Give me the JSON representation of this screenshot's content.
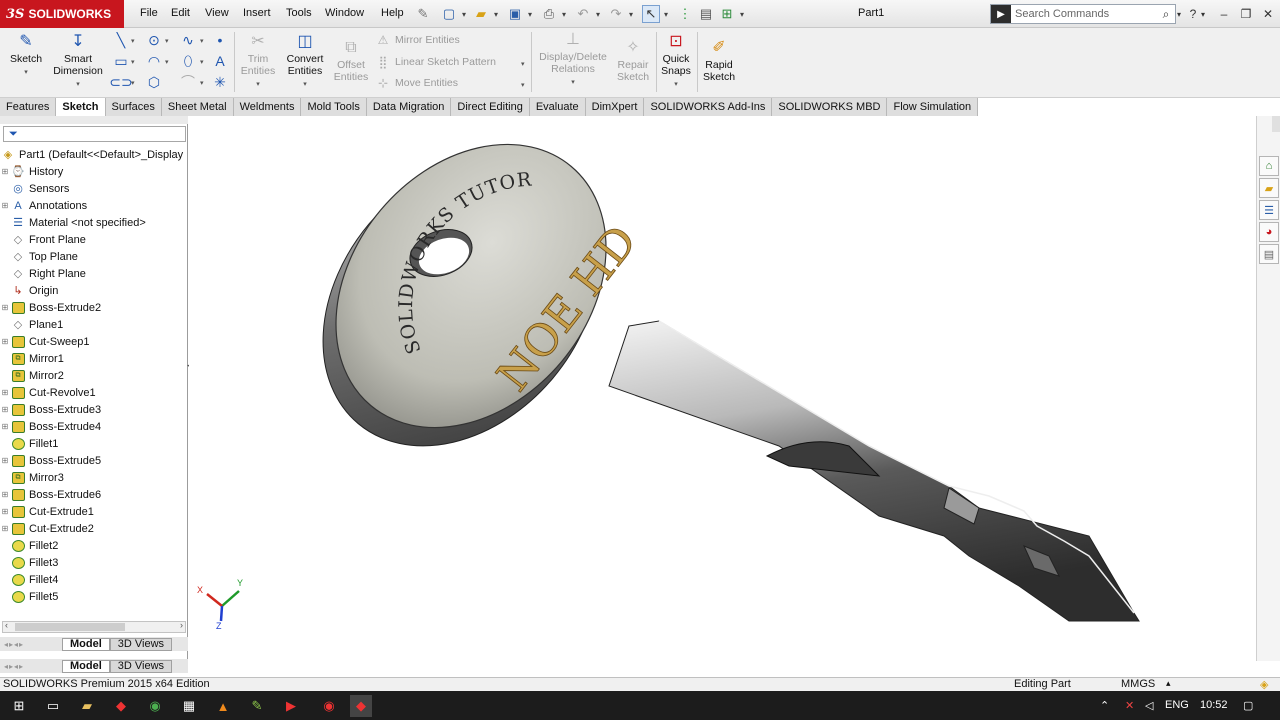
{
  "app": {
    "logo": "SOLIDWORKS",
    "logo_mark": "3S",
    "document_title": "Part1"
  },
  "menu": [
    "File",
    "Edit",
    "View",
    "Insert",
    "Tools",
    "Window",
    "Help"
  ],
  "search": {
    "placeholder": "Search Commands"
  },
  "commands": {
    "sketch": "Sketch",
    "smart_dimension_1": "Smart",
    "smart_dimension_2": "Dimension",
    "trim_1": "Trim",
    "trim_2": "Entities",
    "convert_1": "Convert",
    "convert_2": "Entities",
    "offset_1": "Offset",
    "offset_2": "Entities",
    "mirror_entities": "Mirror Entities",
    "linear_pattern": "Linear Sketch Pattern",
    "move_entities": "Move Entities",
    "display_delete_1": "Display/Delete",
    "display_delete_2": "Relations",
    "repair_1": "Repair",
    "repair_2": "Sketch",
    "quick_snaps_1": "Quick",
    "quick_snaps_2": "Snaps",
    "rapid_sketch_1": "Rapid",
    "rapid_sketch_2": "Sketch"
  },
  "tabs": [
    "Features",
    "Sketch",
    "Surfaces",
    "Sheet Metal",
    "Weldments",
    "Mold Tools",
    "Data Migration",
    "Direct Editing",
    "Evaluate",
    "DimXpert",
    "SOLIDWORKS Add-Ins",
    "SOLIDWORKS MBD",
    "Flow Simulation"
  ],
  "active_tab": "Sketch",
  "tree": {
    "root": "Part1  (Default<<Default>_Display",
    "items": [
      {
        "label": "History",
        "icon": "history-icon"
      },
      {
        "label": "Sensors",
        "icon": "sensor-icon"
      },
      {
        "label": "Annotations",
        "icon": "annotation-icon"
      },
      {
        "label": "Material <not specified>",
        "icon": "material-icon"
      },
      {
        "label": "Front Plane",
        "icon": "plane-icon"
      },
      {
        "label": "Top Plane",
        "icon": "plane-icon"
      },
      {
        "label": "Right Plane",
        "icon": "plane-icon"
      },
      {
        "label": "Origin",
        "icon": "origin-icon"
      },
      {
        "label": "Boss-Extrude2",
        "icon": "feature-icon"
      },
      {
        "label": "Plane1",
        "icon": "plane-icon"
      },
      {
        "label": "Cut-Sweep1",
        "icon": "feature-icon"
      },
      {
        "label": "Mirror1",
        "icon": "mirror-icon"
      },
      {
        "label": "Mirror2",
        "icon": "mirror-icon"
      },
      {
        "label": "Cut-Revolve1",
        "icon": "feature-icon"
      },
      {
        "label": "Boss-Extrude3",
        "icon": "feature-icon"
      },
      {
        "label": "Boss-Extrude4",
        "icon": "feature-icon"
      },
      {
        "label": "Fillet1",
        "icon": "fillet-icon"
      },
      {
        "label": "Boss-Extrude5",
        "icon": "feature-icon"
      },
      {
        "label": "Mirror3",
        "icon": "mirror-icon"
      },
      {
        "label": "Boss-Extrude6",
        "icon": "feature-icon"
      },
      {
        "label": "Cut-Extrude1",
        "icon": "feature-icon"
      },
      {
        "label": "Cut-Extrude2",
        "icon": "feature-icon"
      },
      {
        "label": "Fillet2",
        "icon": "fillet-icon"
      },
      {
        "label": "Fillet3",
        "icon": "fillet-icon"
      },
      {
        "label": "Fillet4",
        "icon": "fillet-icon"
      },
      {
        "label": "Fillet5",
        "icon": "fillet-icon"
      }
    ]
  },
  "panel_tabs": {
    "model": "Model",
    "views": "3D Views"
  },
  "model": {
    "engraving_1": "SOLIDWORKS TUTORIAL",
    "engraving_2": "NOE HD",
    "triad_x": "X",
    "triad_y": "Y",
    "triad_z": "Z"
  },
  "status": {
    "edition": "SOLIDWORKS Premium 2015 x64 Edition",
    "mode": "Editing Part",
    "units": "MMGS"
  },
  "taskbar": {
    "language": "ENG",
    "time": "10:52"
  }
}
